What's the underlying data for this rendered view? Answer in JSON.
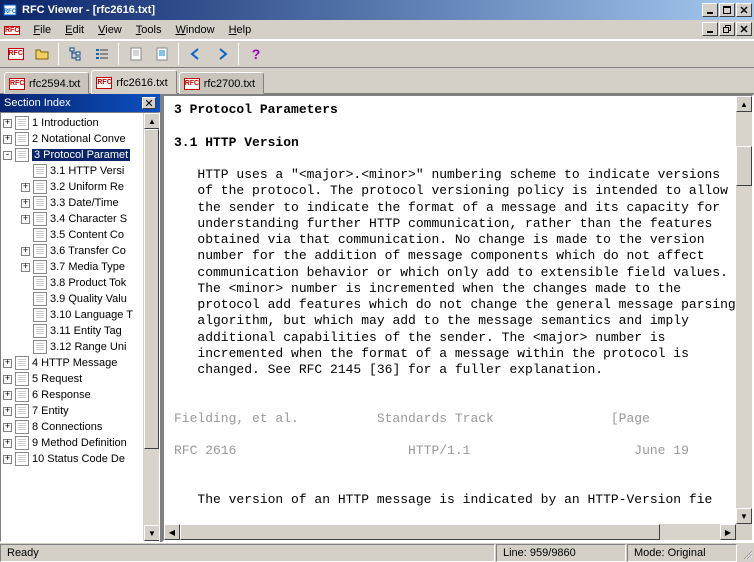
{
  "window": {
    "title": "RFC Viewer - [rfc2616.txt]"
  },
  "menu": {
    "file": "File",
    "edit": "Edit",
    "view": "View",
    "tools": "Tools",
    "window": "Window",
    "help": "Help"
  },
  "tabs": [
    {
      "label": "rfc2594.txt",
      "active": false
    },
    {
      "label": "rfc2616.txt",
      "active": true
    },
    {
      "label": "rfc2700.txt",
      "active": false
    }
  ],
  "sidebar": {
    "title": "Section Index",
    "nodes": [
      {
        "depth": 0,
        "expand": "+",
        "label": "1 Introduction",
        "selected": false
      },
      {
        "depth": 0,
        "expand": "+",
        "label": "2 Notational Conve",
        "selected": false
      },
      {
        "depth": 0,
        "expand": "-",
        "label": "3 Protocol Paramet",
        "selected": true
      },
      {
        "depth": 1,
        "expand": "",
        "label": "3.1 HTTP Versi",
        "selected": false
      },
      {
        "depth": 1,
        "expand": "+",
        "label": "3.2 Uniform Re",
        "selected": false
      },
      {
        "depth": 1,
        "expand": "+",
        "label": "3.3 Date/Time ",
        "selected": false
      },
      {
        "depth": 1,
        "expand": "+",
        "label": "3.4 Character S",
        "selected": false
      },
      {
        "depth": 1,
        "expand": "",
        "label": "3.5 Content Co",
        "selected": false
      },
      {
        "depth": 1,
        "expand": "+",
        "label": "3.6 Transfer Co",
        "selected": false
      },
      {
        "depth": 1,
        "expand": "+",
        "label": "3.7 Media Type",
        "selected": false
      },
      {
        "depth": 1,
        "expand": "",
        "label": "3.8 Product Tok",
        "selected": false
      },
      {
        "depth": 1,
        "expand": "",
        "label": "3.9 Quality Valu",
        "selected": false
      },
      {
        "depth": 1,
        "expand": "",
        "label": "3.10 Language T",
        "selected": false
      },
      {
        "depth": 1,
        "expand": "",
        "label": "3.11 Entity Tag",
        "selected": false
      },
      {
        "depth": 1,
        "expand": "",
        "label": "3.12 Range Uni",
        "selected": false
      },
      {
        "depth": 0,
        "expand": "+",
        "label": "4 HTTP Message",
        "selected": false
      },
      {
        "depth": 0,
        "expand": "+",
        "label": "5 Request",
        "selected": false
      },
      {
        "depth": 0,
        "expand": "+",
        "label": "6 Response",
        "selected": false
      },
      {
        "depth": 0,
        "expand": "+",
        "label": "7 Entity",
        "selected": false
      },
      {
        "depth": 0,
        "expand": "+",
        "label": "8 Connections",
        "selected": false
      },
      {
        "depth": 0,
        "expand": "+",
        "label": "9 Method Definition",
        "selected": false
      },
      {
        "depth": 0,
        "expand": "+",
        "label": "10 Status Code De",
        "selected": false
      }
    ]
  },
  "content": {
    "h1": "3 Protocol Parameters",
    "h2": "3.1 HTTP Version",
    "body": "   HTTP uses a \"<major>.<minor>\" numbering scheme to indicate versions\n   of the protocol. The protocol versioning policy is intended to allow\n   the sender to indicate the format of a message and its capacity for\n   understanding further HTTP communication, rather than the features\n   obtained via that communication. No change is made to the version\n   number for the addition of message components which do not affect\n   communication behavior or which only add to extensible field values.\n   The <minor> number is incremented when the changes made to the\n   protocol add features which do not change the general message parsing\n   algorithm, but which may add to the message semantics and imply\n   additional capabilities of the sender. The <major> number is\n   incremented when the format of a message within the protocol is\n   changed. See RFC 2145 [36] for a fuller explanation.",
    "footer1_left": "Fielding, et al.",
    "footer1_mid": "Standards Track",
    "footer1_right": "[Page",
    "footer2_left": "RFC 2616",
    "footer2_mid": "HTTP/1.1",
    "footer2_right": "June 19",
    "body2": "   The version of an HTTP message is indicated by an HTTP-Version fie"
  },
  "status": {
    "ready": "Ready",
    "line": "Line: 959/9860",
    "mode": "Mode: Original"
  }
}
